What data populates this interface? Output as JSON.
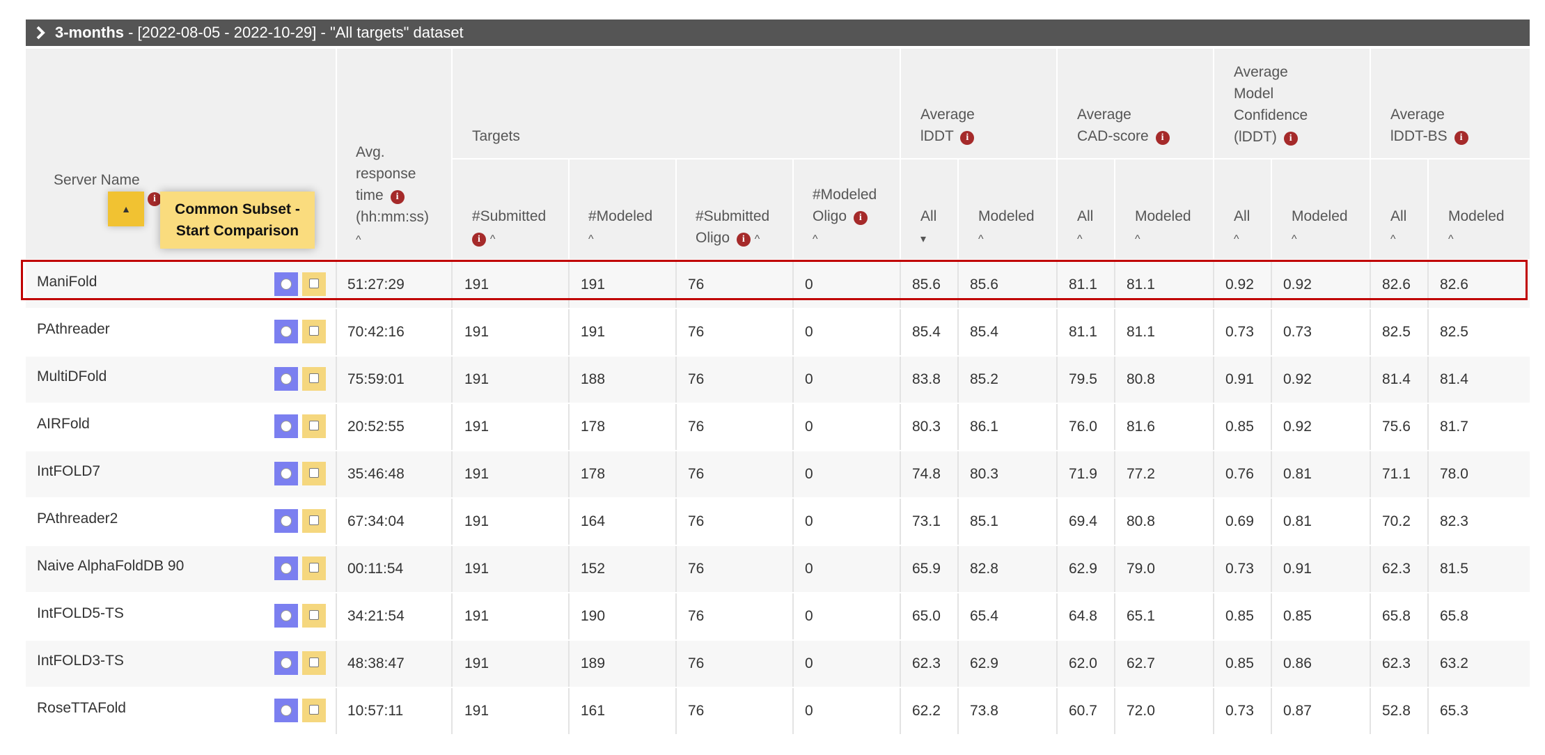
{
  "panel": {
    "title_bold": "3-months",
    "title_rest": " - [2022-08-05 - 2022-10-29] - \"All targets\" dataset",
    "expand_icon": "chevron-right-icon"
  },
  "header": {
    "server_name": "Server Name",
    "common_subset_line1": "Common Subset -",
    "common_subset_line2": "Start Comparison",
    "avg_response_lines": [
      "Avg.",
      "response",
      "time",
      "(hh:mm:ss)"
    ],
    "targets": "Targets",
    "submitted": "#Submitted",
    "modeled": "#Modeled",
    "submitted_oligo_lines": [
      "#Submitted",
      "Oligo"
    ],
    "modeled_oligo_lines": [
      "#Modeled",
      "Oligo"
    ],
    "lddt_lines": [
      "Average",
      "lDDT"
    ],
    "cad_lines": [
      "Average",
      "CAD-score"
    ],
    "conf_lines": [
      "Average",
      "Model",
      "Confidence",
      "(lDDT)"
    ],
    "lddtbs_lines": [
      "Average",
      "lDDT-BS"
    ],
    "all": "All",
    "modeled_sub": "Modeled",
    "sort_up": "^",
    "sort_down": "▾",
    "sort_button": "▲",
    "info": "i"
  },
  "colors": {
    "title_bar": "#555555",
    "header_bg": "#f0f0f0",
    "info_icon": "#a52a2a",
    "sort_button": "#f1c232",
    "compare_button": "#fadc7e",
    "radio_bg": "#7b7ff0",
    "checkbox_bg": "#f5d77e",
    "highlight_border": "#c00000"
  },
  "rows": [
    {
      "name": "ManiFold",
      "time": "51:27:29",
      "submitted": "191",
      "modeled": "191",
      "sub_oligo": "76",
      "mod_oligo": "0",
      "lddt_all": "85.6",
      "lddt_mod": "85.6",
      "cad_all": "81.1",
      "cad_mod": "81.1",
      "conf_all": "0.92",
      "conf_mod": "0.92",
      "bs_all": "82.6",
      "bs_mod": "82.6"
    },
    {
      "name": "PAthreader",
      "time": "70:42:16",
      "submitted": "191",
      "modeled": "191",
      "sub_oligo": "76",
      "mod_oligo": "0",
      "lddt_all": "85.4",
      "lddt_mod": "85.4",
      "cad_all": "81.1",
      "cad_mod": "81.1",
      "conf_all": "0.73",
      "conf_mod": "0.73",
      "bs_all": "82.5",
      "bs_mod": "82.5"
    },
    {
      "name": "MultiDFold",
      "time": "75:59:01",
      "submitted": "191",
      "modeled": "188",
      "sub_oligo": "76",
      "mod_oligo": "0",
      "lddt_all": "83.8",
      "lddt_mod": "85.2",
      "cad_all": "79.5",
      "cad_mod": "80.8",
      "conf_all": "0.91",
      "conf_mod": "0.92",
      "bs_all": "81.4",
      "bs_mod": "81.4"
    },
    {
      "name": "AIRFold",
      "time": "20:52:55",
      "submitted": "191",
      "modeled": "178",
      "sub_oligo": "76",
      "mod_oligo": "0",
      "lddt_all": "80.3",
      "lddt_mod": "86.1",
      "cad_all": "76.0",
      "cad_mod": "81.6",
      "conf_all": "0.85",
      "conf_mod": "0.92",
      "bs_all": "75.6",
      "bs_mod": "81.7"
    },
    {
      "name": "IntFOLD7",
      "time": "35:46:48",
      "submitted": "191",
      "modeled": "178",
      "sub_oligo": "76",
      "mod_oligo": "0",
      "lddt_all": "74.8",
      "lddt_mod": "80.3",
      "cad_all": "71.9",
      "cad_mod": "77.2",
      "conf_all": "0.76",
      "conf_mod": "0.81",
      "bs_all": "71.1",
      "bs_mod": "78.0"
    },
    {
      "name": "PAthreader2",
      "time": "67:34:04",
      "submitted": "191",
      "modeled": "164",
      "sub_oligo": "76",
      "mod_oligo": "0",
      "lddt_all": "73.1",
      "lddt_mod": "85.1",
      "cad_all": "69.4",
      "cad_mod": "80.8",
      "conf_all": "0.69",
      "conf_mod": "0.81",
      "bs_all": "70.2",
      "bs_mod": "82.3"
    },
    {
      "name": "Naive AlphaFoldDB 90",
      "time": "00:11:54",
      "submitted": "191",
      "modeled": "152",
      "sub_oligo": "76",
      "mod_oligo": "0",
      "lddt_all": "65.9",
      "lddt_mod": "82.8",
      "cad_all": "62.9",
      "cad_mod": "79.0",
      "conf_all": "0.73",
      "conf_mod": "0.91",
      "bs_all": "62.3",
      "bs_mod": "81.5"
    },
    {
      "name": "IntFOLD5-TS",
      "time": "34:21:54",
      "submitted": "191",
      "modeled": "190",
      "sub_oligo": "76",
      "mod_oligo": "0",
      "lddt_all": "65.0",
      "lddt_mod": "65.4",
      "cad_all": "64.8",
      "cad_mod": "65.1",
      "conf_all": "0.85",
      "conf_mod": "0.85",
      "bs_all": "65.8",
      "bs_mod": "65.8"
    },
    {
      "name": "IntFOLD3-TS",
      "time": "48:38:47",
      "submitted": "191",
      "modeled": "189",
      "sub_oligo": "76",
      "mod_oligo": "0",
      "lddt_all": "62.3",
      "lddt_mod": "62.9",
      "cad_all": "62.0",
      "cad_mod": "62.7",
      "conf_all": "0.85",
      "conf_mod": "0.86",
      "bs_all": "62.3",
      "bs_mod": "63.2"
    },
    {
      "name": "RoseTTAFold",
      "time": "10:57:11",
      "submitted": "191",
      "modeled": "161",
      "sub_oligo": "76",
      "mod_oligo": "0",
      "lddt_all": "62.2",
      "lddt_mod": "73.8",
      "cad_all": "60.7",
      "cad_mod": "72.0",
      "conf_all": "0.73",
      "conf_mod": "0.87",
      "bs_all": "52.8",
      "bs_mod": "65.3"
    }
  ]
}
